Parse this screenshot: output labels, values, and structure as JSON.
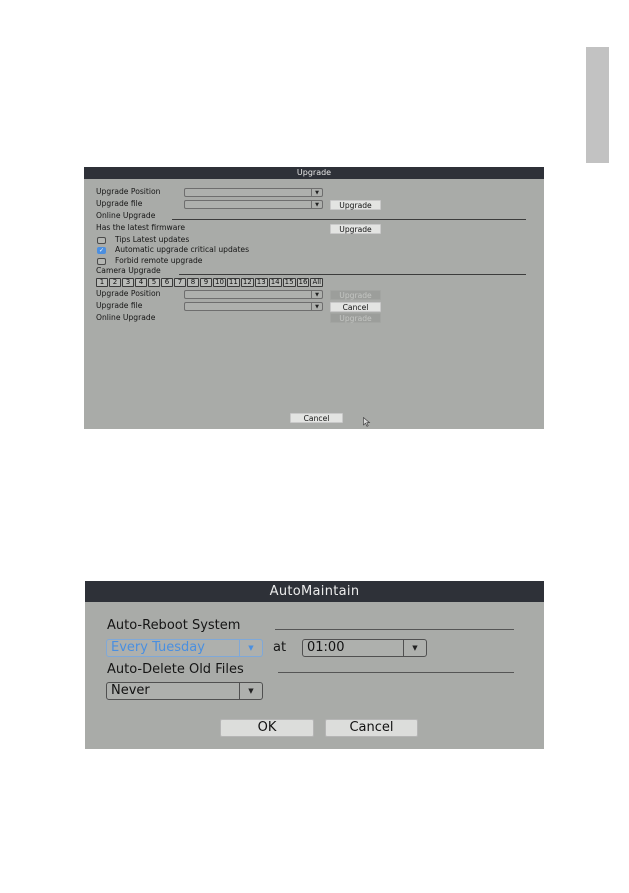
{
  "page": {
    "side_tab_color": "#c2c2c2"
  },
  "upgrade_dialog": {
    "title": "Upgrade",
    "upgrade_position_label": "Upgrade Position",
    "upgrade_position_value": "",
    "upgrade_file_label": "Upgrade file",
    "upgrade_file_value": "",
    "upgrade_button": "Upgrade",
    "online_upgrade_section": "Online Upgrade",
    "firmware_status": "Has the latest firmware",
    "online_upgrade_button": "Upgrade",
    "checkboxes": [
      {
        "label": "Tips Latest updates",
        "checked": false
      },
      {
        "label": "Automatic upgrade critical updates",
        "checked": true
      },
      {
        "label": "Forbid remote upgrade",
        "checked": false
      }
    ],
    "camera_upgrade_section": "Camera Upgrade",
    "channels": [
      "1",
      "2",
      "3",
      "4",
      "5",
      "6",
      "7",
      "8",
      "9",
      "10",
      "11",
      "12",
      "13",
      "14",
      "15",
      "16",
      "All"
    ],
    "camera": {
      "upgrade_position_label": "Upgrade Position",
      "upgrade_position_value": "",
      "upgrade_position_button": "Upgrade",
      "upgrade_file_label": "Upgrade file",
      "upgrade_file_value": "",
      "cancel_button": "Cancel",
      "online_upgrade_label": "Online Upgrade",
      "online_upgrade_button": "Upgrade"
    },
    "cancel_button": "Cancel",
    "dropdown_arrow": "▼",
    "check_mark": "✓"
  },
  "automaintain_dialog": {
    "title": "AutoMaintain",
    "auto_reboot_section": "Auto-Reboot System",
    "reboot_day_value": "Every Tuesday",
    "at_label": "at",
    "reboot_time_value": "01:00",
    "auto_delete_section": "Auto-Delete Old Files",
    "delete_value": "Never",
    "ok_button": "OK",
    "cancel_button": "Cancel",
    "dropdown_arrow": "▼",
    "accent_color": "#4a8fe0"
  }
}
